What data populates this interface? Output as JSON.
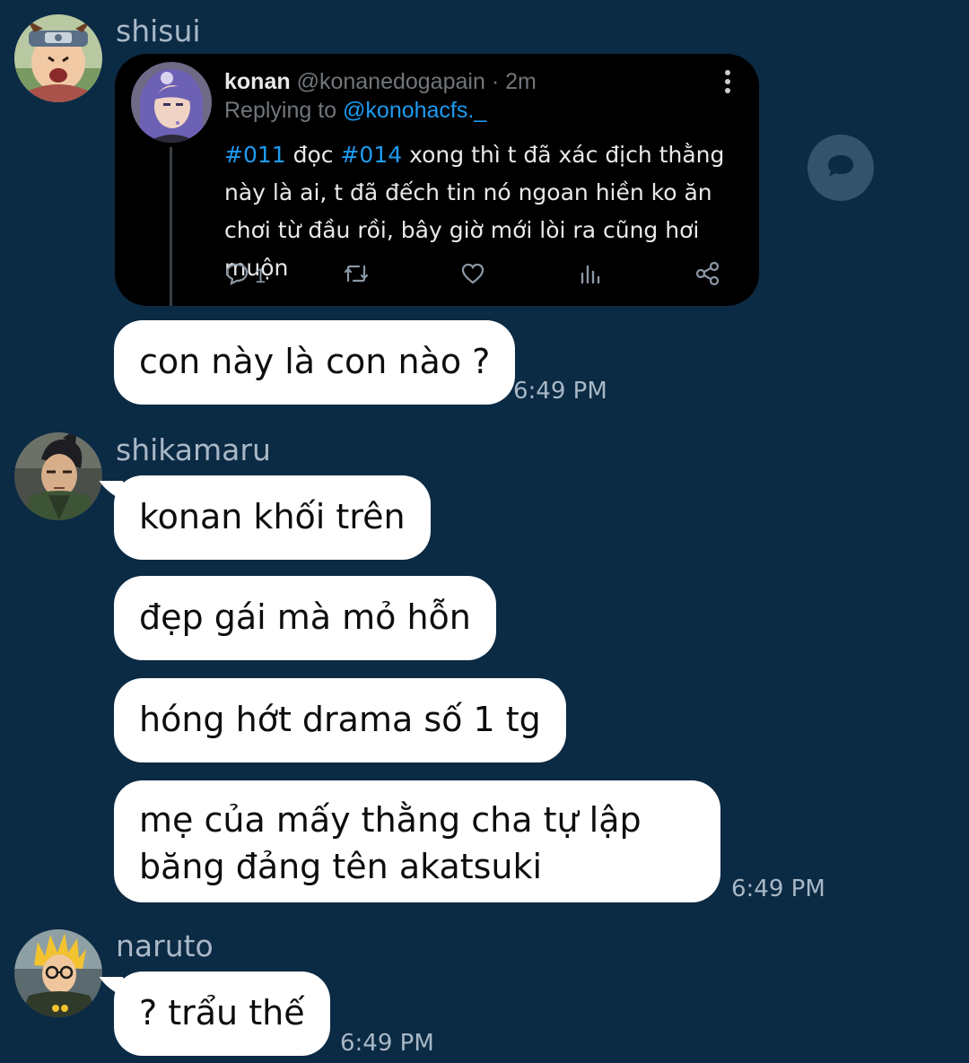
{
  "messages": [
    {
      "sender": "shisui",
      "tweet": {
        "author_name": "konan",
        "author_handle": "@konanedogapain",
        "time_ago": "· 2m",
        "replying_label": "Replying to",
        "replying_to": "@konohacfs._",
        "hashtag1": "#011",
        "text1": " đọc ",
        "hashtag2": "#014",
        "text2": " xong thì t đã xác địch thằng này là ai, t đã đếch tin nó ngoan hiền ko ăn chơi từ đầu rồi, bây giờ mới lòi ra cũng hơi muộn",
        "reply_count": "1"
      },
      "text": "con này là con nào ?",
      "time": "6:49 PM"
    },
    {
      "sender": "shikamaru",
      "texts": [
        "konan khối trên",
        "đẹp gái mà mỏ hỗn",
        "hóng hớt drama số 1 tg",
        "mẹ của mấy thằng cha tự lập",
        "băng đảng tên akatsuki"
      ],
      "time": "6:49 PM"
    },
    {
      "sender": "naruto",
      "text": "? trẩu thế",
      "time": "6:49 PM"
    }
  ],
  "icons": {
    "share": "share-speech-bubble-icon",
    "reply": "reply-icon",
    "retweet": "retweet-icon",
    "like": "heart-icon",
    "views": "views-bar-icon",
    "tweet_share": "share-nodes-icon",
    "more": "more-vertical-icon"
  },
  "colors": {
    "background": "#0b2a44",
    "bubble": "#ffffff",
    "meta_text": "#a9b8c6",
    "tweet_bg": "#000000",
    "tweet_link": "#1d9bf0"
  }
}
